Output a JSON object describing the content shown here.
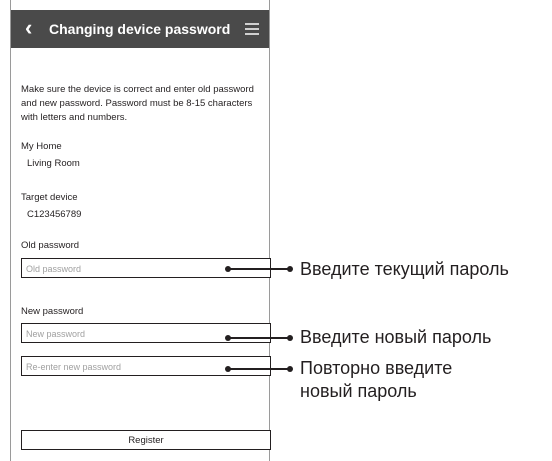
{
  "header": {
    "title": "Changing device password"
  },
  "description": "Make sure the device is correct and enter old password and new password. Password must be 8-15 characters with letters and numbers.",
  "home": {
    "label": "My Home",
    "value": "Living Room"
  },
  "target": {
    "label": "Target device",
    "value": "C123456789"
  },
  "old_password": {
    "label": "Old password",
    "placeholder": "Old password"
  },
  "new_password": {
    "label": "New password",
    "placeholder": "New password",
    "reenter_placeholder": "Re-enter new password"
  },
  "register_label": "Register",
  "annotations": {
    "old": "Введите текущий пароль",
    "new": "Введите новый пароль",
    "reenter_line1": "Повторно введите",
    "reenter_line2": "новый пароль"
  }
}
